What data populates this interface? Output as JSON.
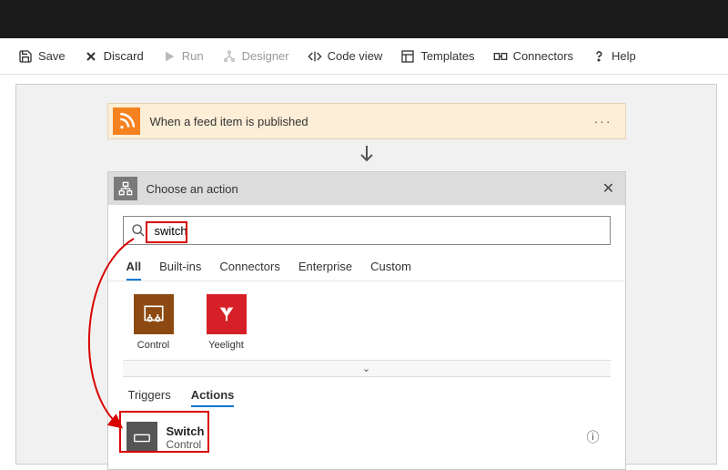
{
  "toolbar": {
    "save": "Save",
    "discard": "Discard",
    "run": "Run",
    "designer": "Designer",
    "codeview": "Code view",
    "templates": "Templates",
    "connectors": "Connectors",
    "help": "Help"
  },
  "trigger": {
    "title": "When a feed item is published",
    "more": "···"
  },
  "actionPanel": {
    "title": "Choose an action",
    "closeGlyph": "✕"
  },
  "search": {
    "value": "switch",
    "placeholder": ""
  },
  "filterTabs": [
    "All",
    "Built-ins",
    "Connectors",
    "Enterprise",
    "Custom"
  ],
  "activeFilterTab": 0,
  "connectors": [
    {
      "label": "Control"
    },
    {
      "label": "Yeelight"
    }
  ],
  "expandGlyph": "⌄",
  "subTabs": [
    "Triggers",
    "Actions"
  ],
  "activeSubTab": 1,
  "actions": [
    {
      "title": "Switch",
      "subtitle": "Control",
      "infoGlyph": "ⓘ"
    }
  ]
}
